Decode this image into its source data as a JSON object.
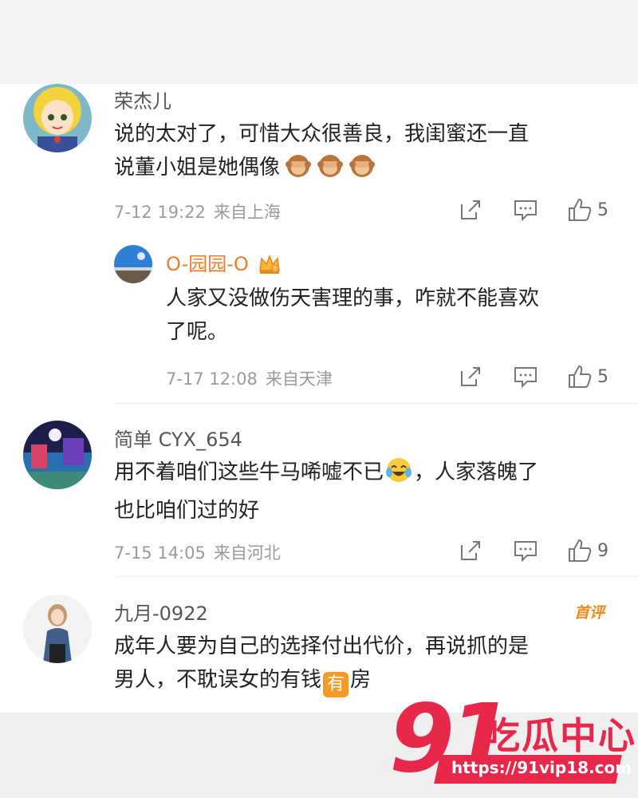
{
  "colors": {
    "accent_orange": "#f07d26",
    "watermark_red": "#e8284b",
    "meta_gray": "#9a9a9a"
  },
  "comments": [
    {
      "username": "荣杰儿",
      "text_line1": "说的太对了，可惜大众很善良，我闺蜜还一直",
      "text_line2": "说董小姐是她偶像",
      "emojis": [
        "see-no-evil-monkey",
        "see-no-evil-monkey",
        "see-no-evil-monkey"
      ],
      "date": "7-12 19:22",
      "location": "来自上海",
      "likes": "5",
      "reply": {
        "username": "O-园园-O",
        "badge_icon": "crown-icon",
        "text_line1": "人家又没做伤天害理的事，咋就不能喜欢",
        "text_line2": "了呢。",
        "date": "7-17 12:08",
        "location": "来自天津",
        "likes": "5"
      }
    },
    {
      "username": "简单 CYX_654",
      "text_line1a": "用不着咱们这些牛马唏嘘不已",
      "emoji": "laughing-crying-face",
      "text_line1b": "，人家落魄了",
      "text_line2": "也比咱们过的好",
      "date": "7-15 14:05",
      "location": "来自河北",
      "likes": "9"
    },
    {
      "username": "九月-0922",
      "badge": "首评",
      "text_line1": "成年人要为自己的选择付出代价，再说抓的是",
      "text_line2a": "男人，不耽误女的有钱",
      "inline_badge": "有",
      "text_line2b": "房"
    }
  ],
  "watermark": {
    "number": "91",
    "chinese": "吃瓜中心",
    "url": "https://91vip18.com"
  }
}
